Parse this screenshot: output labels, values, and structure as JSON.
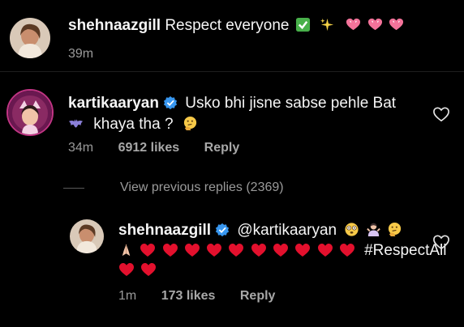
{
  "comment1": {
    "username": "shehnaazgill",
    "text": "Respect everyone",
    "time": "39m"
  },
  "comment2": {
    "username": "kartikaaryan",
    "text_line1": "Usko bhi jisne sabse pehle Bat",
    "text_line2": "khaya tha ?",
    "time": "34m",
    "likes": "6912 likes",
    "reply": "Reply"
  },
  "view_previous": "View previous replies (2369)",
  "reply1": {
    "username": "shehnaazgill",
    "mention": "@kartikaaryan",
    "hashtag": "#RespectAll",
    "time": "1m",
    "likes": "173 likes",
    "reply": "Reply"
  },
  "colors": {
    "background": "#000000",
    "verified": "#3897f0",
    "muted": "#9a9a9a",
    "heart": "#e3102d",
    "pink_heart": "#f4739a"
  },
  "icons": [
    "verified-icon",
    "check-emoji-icon",
    "sparkles-icon",
    "heart-icon",
    "thinking-face-icon",
    "bat-icon",
    "like-outline-icon"
  ]
}
